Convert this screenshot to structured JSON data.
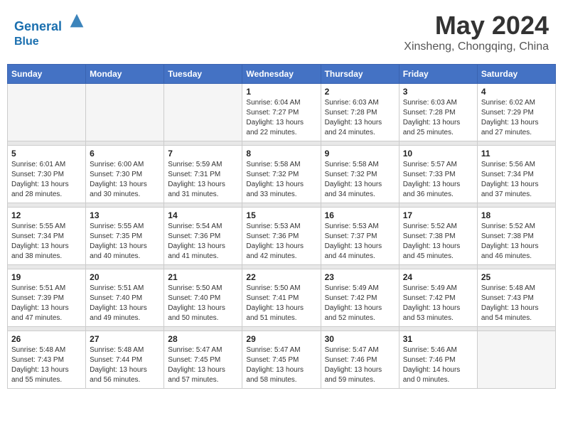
{
  "header": {
    "logo_line1": "General",
    "logo_line2": "Blue",
    "month_year": "May 2024",
    "location": "Xinsheng, Chongqing, China"
  },
  "days_of_week": [
    "Sunday",
    "Monday",
    "Tuesday",
    "Wednesday",
    "Thursday",
    "Friday",
    "Saturday"
  ],
  "weeks": [
    [
      {
        "day": "",
        "empty": true
      },
      {
        "day": "",
        "empty": true
      },
      {
        "day": "",
        "empty": true
      },
      {
        "day": "1",
        "sunrise": "6:04 AM",
        "sunset": "7:27 PM",
        "daylight": "13 hours and 22 minutes."
      },
      {
        "day": "2",
        "sunrise": "6:03 AM",
        "sunset": "7:28 PM",
        "daylight": "13 hours and 24 minutes."
      },
      {
        "day": "3",
        "sunrise": "6:03 AM",
        "sunset": "7:28 PM",
        "daylight": "13 hours and 25 minutes."
      },
      {
        "day": "4",
        "sunrise": "6:02 AM",
        "sunset": "7:29 PM",
        "daylight": "13 hours and 27 minutes."
      }
    ],
    [
      {
        "day": "5",
        "sunrise": "6:01 AM",
        "sunset": "7:30 PM",
        "daylight": "13 hours and 28 minutes."
      },
      {
        "day": "6",
        "sunrise": "6:00 AM",
        "sunset": "7:30 PM",
        "daylight": "13 hours and 30 minutes."
      },
      {
        "day": "7",
        "sunrise": "5:59 AM",
        "sunset": "7:31 PM",
        "daylight": "13 hours and 31 minutes."
      },
      {
        "day": "8",
        "sunrise": "5:58 AM",
        "sunset": "7:32 PM",
        "daylight": "13 hours and 33 minutes."
      },
      {
        "day": "9",
        "sunrise": "5:58 AM",
        "sunset": "7:32 PM",
        "daylight": "13 hours and 34 minutes."
      },
      {
        "day": "10",
        "sunrise": "5:57 AM",
        "sunset": "7:33 PM",
        "daylight": "13 hours and 36 minutes."
      },
      {
        "day": "11",
        "sunrise": "5:56 AM",
        "sunset": "7:34 PM",
        "daylight": "13 hours and 37 minutes."
      }
    ],
    [
      {
        "day": "12",
        "sunrise": "5:55 AM",
        "sunset": "7:34 PM",
        "daylight": "13 hours and 38 minutes."
      },
      {
        "day": "13",
        "sunrise": "5:55 AM",
        "sunset": "7:35 PM",
        "daylight": "13 hours and 40 minutes."
      },
      {
        "day": "14",
        "sunrise": "5:54 AM",
        "sunset": "7:36 PM",
        "daylight": "13 hours and 41 minutes."
      },
      {
        "day": "15",
        "sunrise": "5:53 AM",
        "sunset": "7:36 PM",
        "daylight": "13 hours and 42 minutes."
      },
      {
        "day": "16",
        "sunrise": "5:53 AM",
        "sunset": "7:37 PM",
        "daylight": "13 hours and 44 minutes."
      },
      {
        "day": "17",
        "sunrise": "5:52 AM",
        "sunset": "7:38 PM",
        "daylight": "13 hours and 45 minutes."
      },
      {
        "day": "18",
        "sunrise": "5:52 AM",
        "sunset": "7:38 PM",
        "daylight": "13 hours and 46 minutes."
      }
    ],
    [
      {
        "day": "19",
        "sunrise": "5:51 AM",
        "sunset": "7:39 PM",
        "daylight": "13 hours and 47 minutes."
      },
      {
        "day": "20",
        "sunrise": "5:51 AM",
        "sunset": "7:40 PM",
        "daylight": "13 hours and 49 minutes."
      },
      {
        "day": "21",
        "sunrise": "5:50 AM",
        "sunset": "7:40 PM",
        "daylight": "13 hours and 50 minutes."
      },
      {
        "day": "22",
        "sunrise": "5:50 AM",
        "sunset": "7:41 PM",
        "daylight": "13 hours and 51 minutes."
      },
      {
        "day": "23",
        "sunrise": "5:49 AM",
        "sunset": "7:42 PM",
        "daylight": "13 hours and 52 minutes."
      },
      {
        "day": "24",
        "sunrise": "5:49 AM",
        "sunset": "7:42 PM",
        "daylight": "13 hours and 53 minutes."
      },
      {
        "day": "25",
        "sunrise": "5:48 AM",
        "sunset": "7:43 PM",
        "daylight": "13 hours and 54 minutes."
      }
    ],
    [
      {
        "day": "26",
        "sunrise": "5:48 AM",
        "sunset": "7:43 PM",
        "daylight": "13 hours and 55 minutes."
      },
      {
        "day": "27",
        "sunrise": "5:48 AM",
        "sunset": "7:44 PM",
        "daylight": "13 hours and 56 minutes."
      },
      {
        "day": "28",
        "sunrise": "5:47 AM",
        "sunset": "7:45 PM",
        "daylight": "13 hours and 57 minutes."
      },
      {
        "day": "29",
        "sunrise": "5:47 AM",
        "sunset": "7:45 PM",
        "daylight": "13 hours and 58 minutes."
      },
      {
        "day": "30",
        "sunrise": "5:47 AM",
        "sunset": "7:46 PM",
        "daylight": "13 hours and 59 minutes."
      },
      {
        "day": "31",
        "sunrise": "5:46 AM",
        "sunset": "7:46 PM",
        "daylight": "14 hours and 0 minutes."
      },
      {
        "day": "",
        "empty": true
      }
    ]
  ]
}
